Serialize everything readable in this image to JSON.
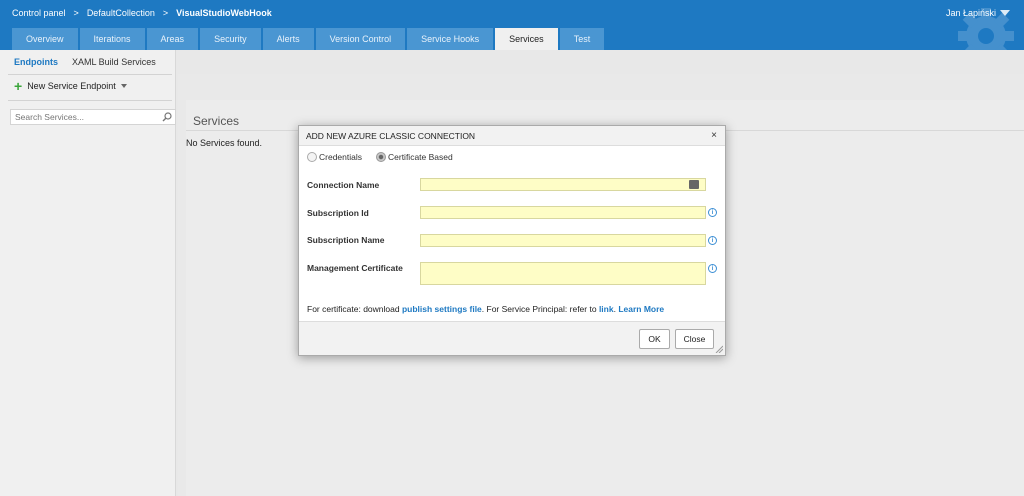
{
  "header": {
    "breadcrumb": [
      "Control panel",
      "DefaultCollection",
      "VisualStudioWebHook"
    ],
    "breadcrumb_sep": ">",
    "user": "Jan Łapiński"
  },
  "tabs": [
    "Overview",
    "Iterations",
    "Areas",
    "Security",
    "Alerts",
    "Version Control",
    "Service Hooks",
    "Services",
    "Test"
  ],
  "active_tab": "Services",
  "subnav": {
    "active": "Endpoints",
    "other": "XAML Build Services"
  },
  "left": {
    "new_endpoint": "New Service Endpoint",
    "search_placeholder": "Search Services..."
  },
  "main": {
    "title": "Services",
    "empty": "No Services found."
  },
  "dialog": {
    "title": "ADD NEW AZURE CLASSIC CONNECTION",
    "close": "×",
    "radio_credentials": "Credentials",
    "radio_certificate": "Certificate Based",
    "selected_radio": "Certificate Based",
    "labels": {
      "connection_name": "Connection Name",
      "subscription_id": "Subscription Id",
      "subscription_name": "Subscription Name",
      "management_certificate": "Management Certificate"
    },
    "note_prefix": "For certificate: download ",
    "note_link1": "publish settings file",
    "note_mid": ". For Service Principal: refer to ",
    "note_link2": "link",
    "note_dot": ".",
    "note_link3": "Learn More",
    "ok": "OK",
    "close_button": "Close"
  },
  "colors": {
    "brand": "#1e79c2",
    "field_bg": "#fefdc6"
  }
}
